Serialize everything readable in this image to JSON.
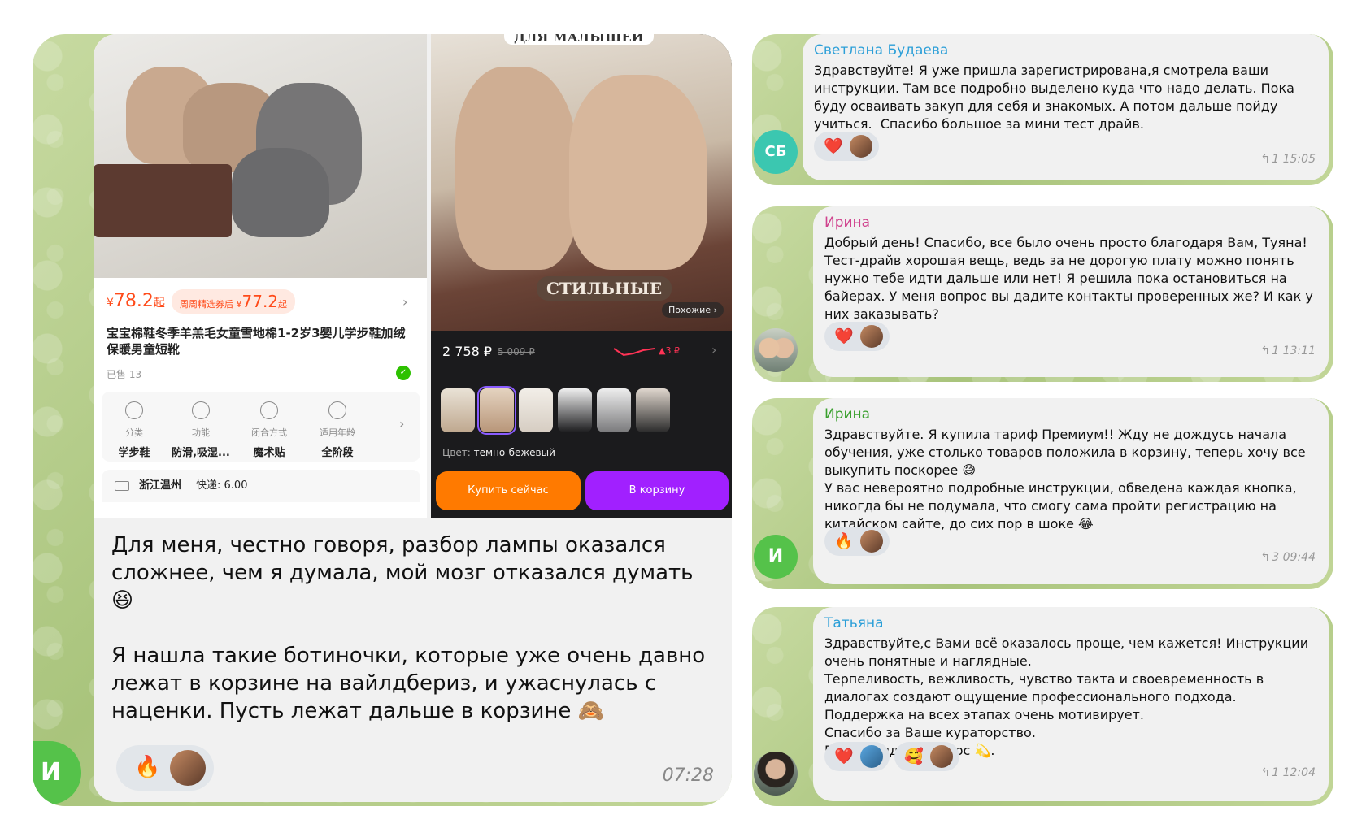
{
  "left": {
    "card_a": {
      "price_symbol": "¥",
      "price": "78.2",
      "price_suffix": "起",
      "coupon_label": "周周精选券后",
      "coupon_symbol": "¥",
      "coupon_price": "77.2",
      "coupon_suffix": "起",
      "title": "宝宝棉鞋冬季羊羔毛女童雪地棉1-2岁3婴儿学步鞋加绒保暖男童短靴",
      "sold": "已售 13",
      "attributes": [
        {
          "key": "分类",
          "value": "学步鞋",
          "icon": "pie-icon"
        },
        {
          "key": "功能",
          "value": "防滑,吸湿...",
          "icon": "clover-icon"
        },
        {
          "key": "闭合方式",
          "value": "魔术贴",
          "icon": "triangle-dots-icon"
        },
        {
          "key": "适用年龄",
          "value": "全阶段",
          "icon": "clock-icon"
        }
      ],
      "ship_location": "浙江温州",
      "ship_fee": "快递: 6.00"
    },
    "card_b": {
      "top_caption": "ДЛЯ МАЛЫШЕЙ",
      "badge": "СТИЛЬНЫЕ",
      "similar": "Похожие ›",
      "price": "2 758 ₽",
      "old_price": "5 009 ₽",
      "trend": "▲3 ₽",
      "color_label": "Цвет: ",
      "color_value": "темно-бежевый",
      "buy_now": "Купить сейчас",
      "to_cart": "В корзину"
    },
    "message_text_1": "Для меня, честно говоря, разбор лампы оказался сложнее, чем я думала, мой мозг отказался думать 😆",
    "message_text_2": "Я нашла такие ботиночки, которые уже очень давно лежат в корзине на вайлдбериз, и ужаснулась с наценки. Пусть лежат дальше в корзине 🙈",
    "reaction": "🔥",
    "time": "07:28",
    "avatar_letter": "И"
  },
  "messages": [
    {
      "name": "Светлана Будаева",
      "name_color": "#2c9fd8",
      "text": "Здравствуйте! Я уже пришла зарегистрирована,я смотрела ваши инструкции. Там все подробно выделено куда что надо делать. Пока буду осваивать закуп для себя и знакомых. А потом дальше пойду учиться.  Спасибо большое за мини тест драйв.",
      "reaction": "❤️",
      "replies": "1",
      "time": "15:05",
      "avatar_letters": "СБ",
      "avatar_color": "#3bc7b0"
    },
    {
      "name": "Ирина",
      "name_color": "#d0438e",
      "text": "Добрый день! Спасибо, все было очень просто благодаря Вам, Туяна! Тест-драйв хорошая вещь, ведь за не дорогую плату можно понять нужно тебе идти дальше или нет! Я решила пока остановиться на байерах. У меня вопрос вы дадите контакты проверенных же? И как у них заказывать?",
      "reaction": "❤️",
      "replies": "1",
      "time": "13:11"
    },
    {
      "name": "Ирина",
      "name_color": "#3aa02e",
      "text": "Здравствуйте. Я купила тариф Премиум!! Жду не дождусь начала обучения, уже столько товаров положила в корзину, теперь хочу все выкупить поскорее 😅\nУ вас невероятно подробные инструкции, обведена каждая кнопка, никогда бы не подумала, что смогу сама пройти регистрацию на китайском сайте, до сих пор в шоке 😂",
      "reaction": "🔥",
      "replies": "3",
      "time": "09:44",
      "avatar_letters": "И",
      "avatar_color": "#55c24a"
    },
    {
      "name": "Татьяна",
      "name_color": "#2c9fd8",
      "text": "Здравствуйте,с Вами всё оказалось проще, чем кажется! Инструкции очень понятные и наглядные.\nТерпеливость, вежливость, чувство такта и своевременность в диалогах создают ощущение профессионального подхода.\nПоддержка на всех этапах очень мотивирует.\nСпасибо за Ваше кураторство.\nРешила идти на курс 💫.",
      "reaction": "❤️",
      "reaction_2": "🥰",
      "replies": "1",
      "time": "12:04"
    }
  ]
}
